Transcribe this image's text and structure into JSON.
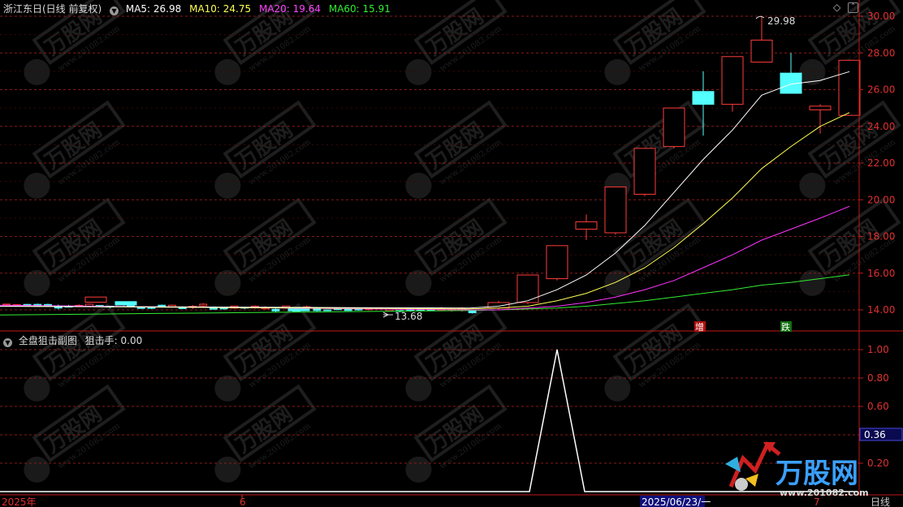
{
  "header": {
    "title": "浙江东日(日线 前复权)",
    "ma5_label": "MA5: 26.98",
    "ma10_label": "MA10: 24.75",
    "ma20_label": "MA20: 19.64",
    "ma60_label": "MA60: 15.91"
  },
  "sub_header": {
    "title": "全盘狙击副图",
    "value_label": "狙击手: 0.00"
  },
  "annotations": {
    "high": "29.98",
    "low": "13.68",
    "tag_zeng": "增",
    "tag_die": "跌",
    "cursor_value": "0.36"
  },
  "x_axis": {
    "label_start": "2025年",
    "label_mid": "6",
    "label_cursor": "2025/06/23/一",
    "label_end": "7",
    "period": "日线"
  },
  "watermark": {
    "brand": "万股网",
    "url": "www.201082.com"
  },
  "colors": {
    "up": "#ff3b3b",
    "down": "#54ffff",
    "ma5": "#ffffff",
    "ma10": "#ffff55",
    "ma20": "#ff33ff",
    "ma60": "#33ee33",
    "grid": "#8a1a1a",
    "axis": "#c01818"
  },
  "chart_data": [
    {
      "type": "candlestick",
      "title": "浙江东日(日线 前复权)",
      "y_ticks": [
        "30.00",
        "28.00",
        "26.00",
        "24.00",
        "22.00",
        "20.00",
        "18.00",
        "16.00",
        "14.00"
      ],
      "ylim": [
        13.4,
        30.3
      ],
      "flat_region": {
        "days": 46,
        "range": [
          13.68,
          14.6
        ]
      },
      "candles": [
        {
          "o": 14.1,
          "c": 14.4,
          "h": 14.5,
          "l": 14.0
        },
        {
          "o": 14.4,
          "c": 15.9,
          "h": 15.9,
          "l": 14.3
        },
        {
          "o": 15.7,
          "c": 17.5,
          "h": 17.5,
          "l": 15.6
        },
        {
          "o": 18.4,
          "c": 18.8,
          "h": 19.2,
          "l": 17.8
        },
        {
          "o": 18.2,
          "c": 20.7,
          "h": 20.7,
          "l": 18.1
        },
        {
          "o": 20.3,
          "c": 22.8,
          "h": 22.8,
          "l": 20.2
        },
        {
          "o": 22.9,
          "c": 25.0,
          "h": 25.0,
          "l": 22.8
        },
        {
          "o": 25.9,
          "c": 25.2,
          "h": 27.0,
          "l": 23.5
        },
        {
          "o": 25.2,
          "c": 27.8,
          "h": 27.8,
          "l": 24.8
        },
        {
          "o": 27.5,
          "c": 28.7,
          "h": 29.98,
          "l": 27.5
        },
        {
          "o": 26.9,
          "c": 25.8,
          "h": 28.0,
          "l": 25.8
        },
        {
          "o": 24.9,
          "c": 25.1,
          "h": 25.2,
          "l": 23.6
        },
        {
          "o": 24.6,
          "c": 27.6,
          "h": 27.6,
          "l": 24.6
        }
      ],
      "ma5": [
        14.2,
        14.5,
        15.1,
        15.9,
        17.1,
        18.6,
        20.4,
        22.2,
        23.8,
        25.7,
        26.3,
        26.5,
        26.98
      ],
      "ma10": [
        14.1,
        14.2,
        14.5,
        14.9,
        15.5,
        16.3,
        17.4,
        18.7,
        20.1,
        21.7,
        22.9,
        24.0,
        24.75
      ],
      "ma20": [
        14.0,
        14.1,
        14.2,
        14.4,
        14.7,
        15.1,
        15.6,
        16.3,
        17.0,
        17.8,
        18.4,
        19.0,
        19.64
      ],
      "ma60": [
        14.0,
        14.05,
        14.1,
        14.2,
        14.35,
        14.5,
        14.7,
        14.9,
        15.1,
        15.35,
        15.5,
        15.7,
        15.91
      ],
      "series_labels": [
        "MA5",
        "MA10",
        "MA20",
        "MA60"
      ]
    },
    {
      "type": "line",
      "title": "全盘狙击副图",
      "series": [
        {
          "name": "狙击手",
          "values": "0 on all days except a single 1.00 spike at the 4th day of the rally"
        }
      ],
      "y_ticks": [
        "1.00",
        "0.80",
        "0.60",
        "0.40",
        "0.20"
      ],
      "ylim": [
        0,
        1.1
      ],
      "spike_index": 3
    }
  ]
}
